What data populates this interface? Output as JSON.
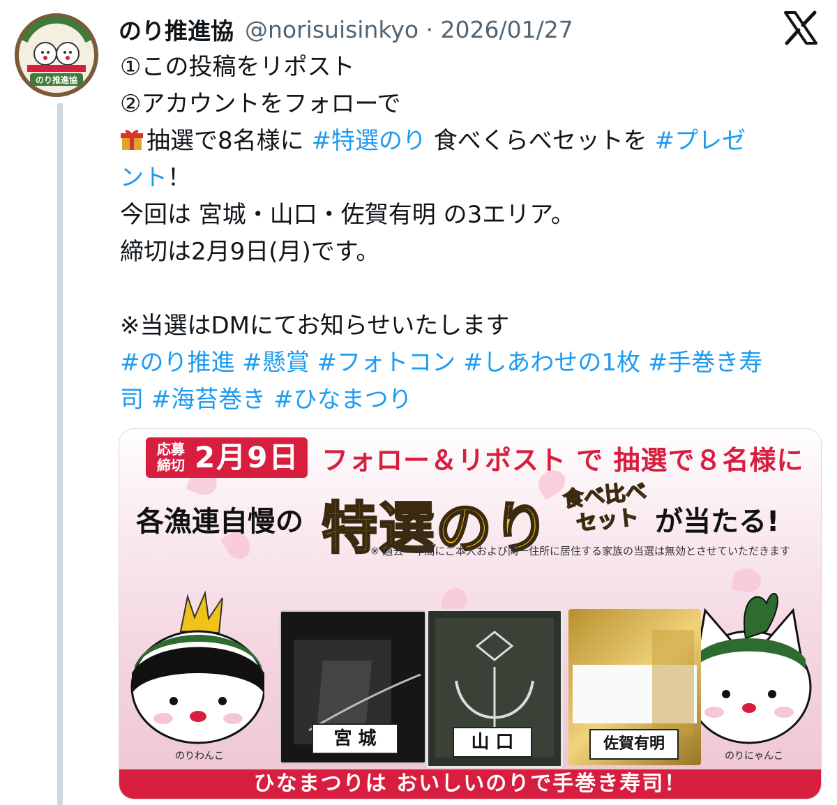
{
  "tweet": {
    "author_name": "のり推進協",
    "author_meta": "@norisuisinkyo · 2026/01/27",
    "lines": [
      "①この投稿をリポスト",
      "②アカウントをフォローで"
    ],
    "line3_pre": "抽選で8名様に ",
    "line3_tag1": "#特選のり",
    "line3_mid": " 食べくらべセットを ",
    "line3_tag2a": "#プレゼ",
    "line4_tag2b": "ント",
    "line4_post": "！",
    "line5": "今回は 宮城・山口・佐賀有明 の3エリア。",
    "line6": "締切は2月9日(月)です。",
    "line7": "※当選はDMにてお知らせいたします",
    "hashtags_line1": "#のり推進 #懸賞 #フォトコン #しあわせの1枚 #手巻き寿",
    "hashtags_line2": "司 #海苔巻き #ひなまつり"
  },
  "banner": {
    "deadline_label": "応募\n締切",
    "deadline_date": "2月9日",
    "headline1": "フォロー＆リポスト で 抽選で８名様に",
    "headline2_pre": "各漁連自慢の",
    "headline2_big": "特選のり",
    "headline2_small": "食べ比べ\nセット",
    "headline2_post": "が当たる!",
    "note": "※ 過去一年間にご本人および同一住所に居住する家族の当選は無効とさせていただきます",
    "mascot_left": "のりわんこ",
    "mascot_right": "のりにゃんこ",
    "packages": [
      "宮 城",
      "山 口",
      "佐賀有明"
    ],
    "footer": "ひなまつりは おいしいのりで手巻き寿司！"
  },
  "colors": {
    "link": "#1d9bf0",
    "banner_red": "#d81e3f",
    "banner_gold": "#f4c21c"
  },
  "icons": [
    "x-logo-icon",
    "gift-icon"
  ]
}
